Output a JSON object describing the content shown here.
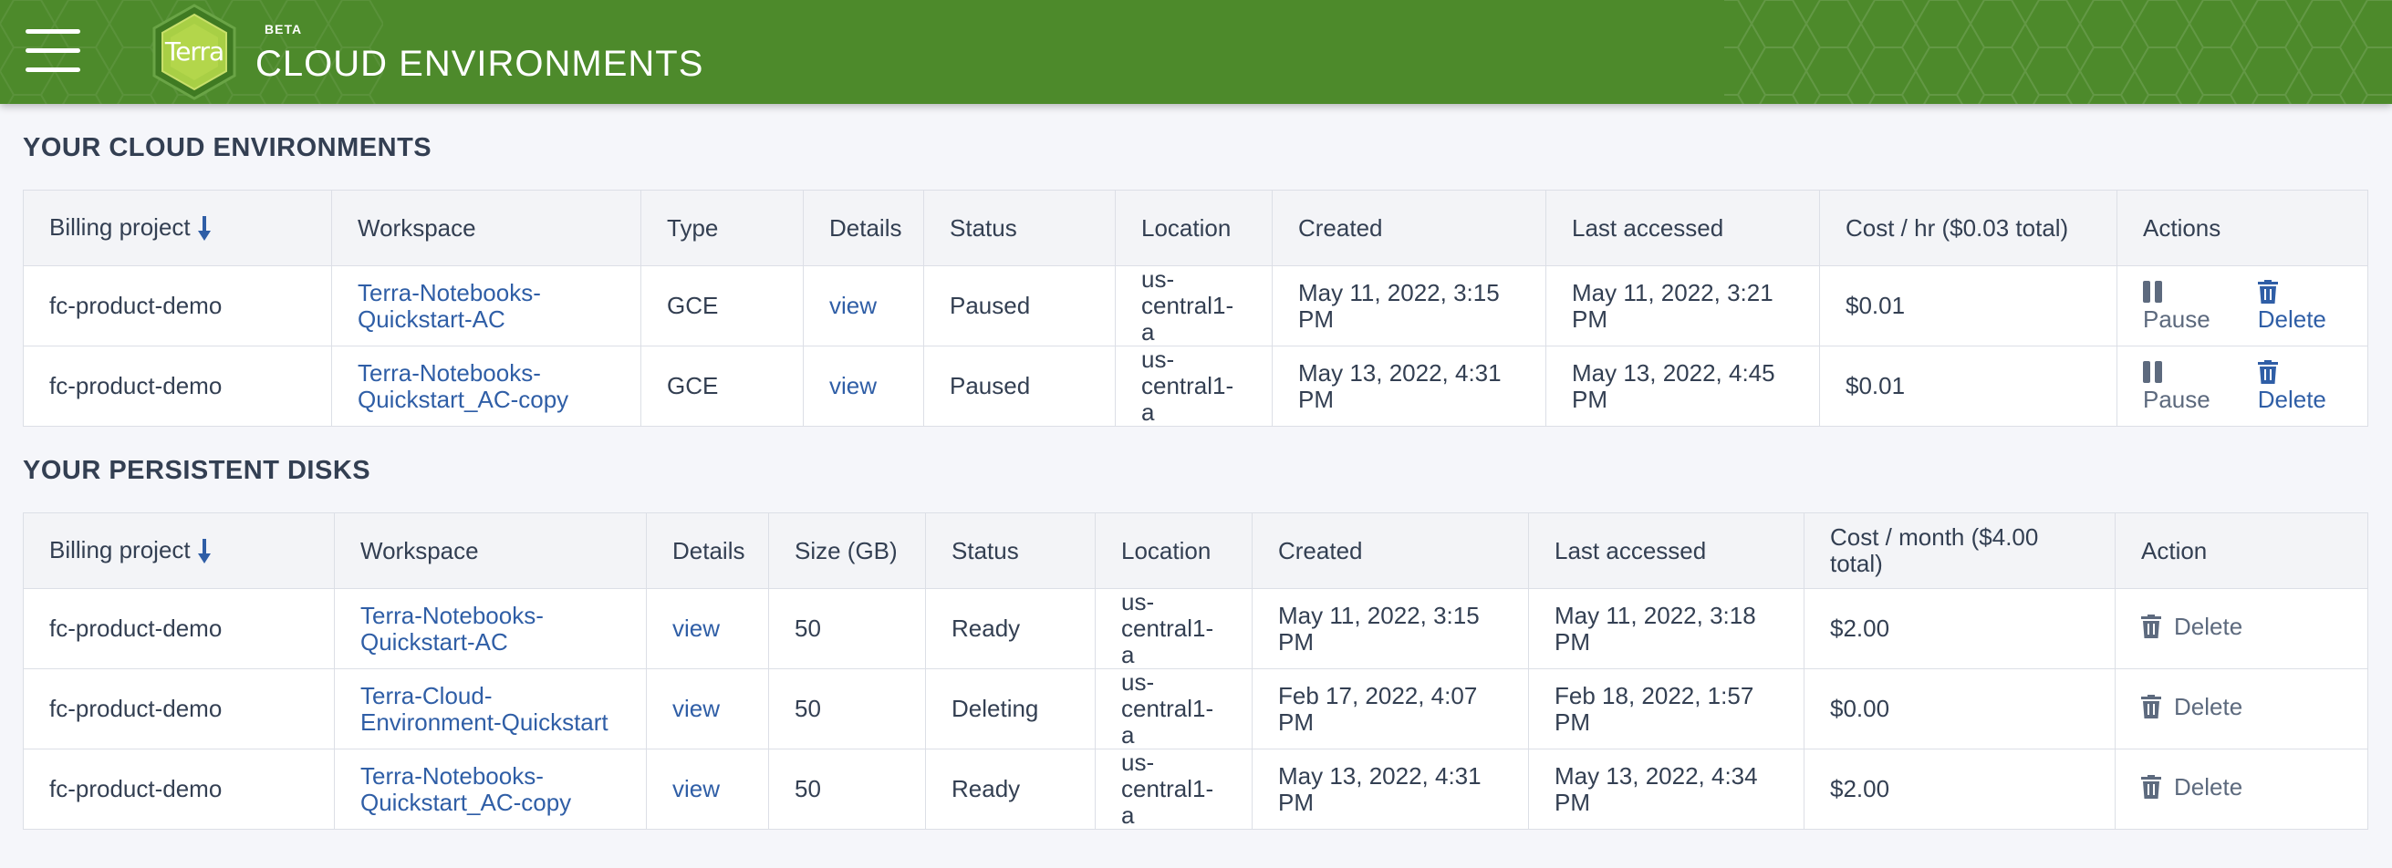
{
  "header": {
    "beta_label": "BETA",
    "title": "CLOUD ENVIRONMENTS",
    "logo_text": "Terra",
    "brand_color": "#4d8a2b"
  },
  "environments": {
    "section_title": "YOUR CLOUD ENVIRONMENTS",
    "columns": {
      "billing": "Billing project",
      "workspace": "Workspace",
      "type": "Type",
      "details": "Details",
      "status": "Status",
      "location": "Location",
      "created": "Created",
      "last_accessed": "Last accessed",
      "cost": "Cost / hr ($0.03 total)",
      "actions": "Actions"
    },
    "rows": [
      {
        "billing": "fc-product-demo",
        "workspace": "Terra-Notebooks-Quickstart-AC",
        "type": "GCE",
        "details": "view",
        "status": "Paused",
        "location": "us-central1-a",
        "created": "May 11, 2022, 3:15 PM",
        "last_accessed": "May 11, 2022, 3:21 PM",
        "cost": "$0.01",
        "pause_label": "Pause",
        "delete_label": "Delete"
      },
      {
        "billing": "fc-product-demo",
        "workspace": "Terra-Notebooks-Quickstart_AC-copy",
        "type": "GCE",
        "details": "view",
        "status": "Paused",
        "location": "us-central1-a",
        "created": "May 13, 2022, 4:31 PM",
        "last_accessed": "May 13, 2022, 4:45 PM",
        "cost": "$0.01",
        "pause_label": "Pause",
        "delete_label": "Delete"
      }
    ]
  },
  "disks": {
    "section_title": "YOUR PERSISTENT DISKS",
    "columns": {
      "billing": "Billing project",
      "workspace": "Workspace",
      "details": "Details",
      "size": "Size (GB)",
      "status": "Status",
      "location": "Location",
      "created": "Created",
      "last_accessed": "Last accessed",
      "cost": "Cost / month ($4.00 total)",
      "action": "Action"
    },
    "rows": [
      {
        "billing": "fc-product-demo",
        "workspace": "Terra-Notebooks-Quickstart-AC",
        "details": "view",
        "size": "50",
        "status": "Ready",
        "location": "us-central1-a",
        "created": "May 11, 2022, 3:15 PM",
        "last_accessed": "May 11, 2022, 3:18 PM",
        "cost": "$2.00",
        "delete_label": "Delete"
      },
      {
        "billing": "fc-product-demo",
        "workspace": "Terra-Cloud-Environment-Quickstart",
        "details": "view",
        "size": "50",
        "status": "Deleting",
        "location": "us-central1-a",
        "created": "Feb 17, 2022, 4:07 PM",
        "last_accessed": "Feb 18, 2022, 1:57 PM",
        "cost": "$0.00",
        "delete_label": "Delete"
      },
      {
        "billing": "fc-product-demo",
        "workspace": "Terra-Notebooks-Quickstart_AC-copy",
        "details": "view",
        "size": "50",
        "status": "Ready",
        "location": "us-central1-a",
        "created": "May 13, 2022, 4:31 PM",
        "last_accessed": "May 13, 2022, 4:34 PM",
        "cost": "$2.00",
        "delete_label": "Delete"
      }
    ]
  }
}
